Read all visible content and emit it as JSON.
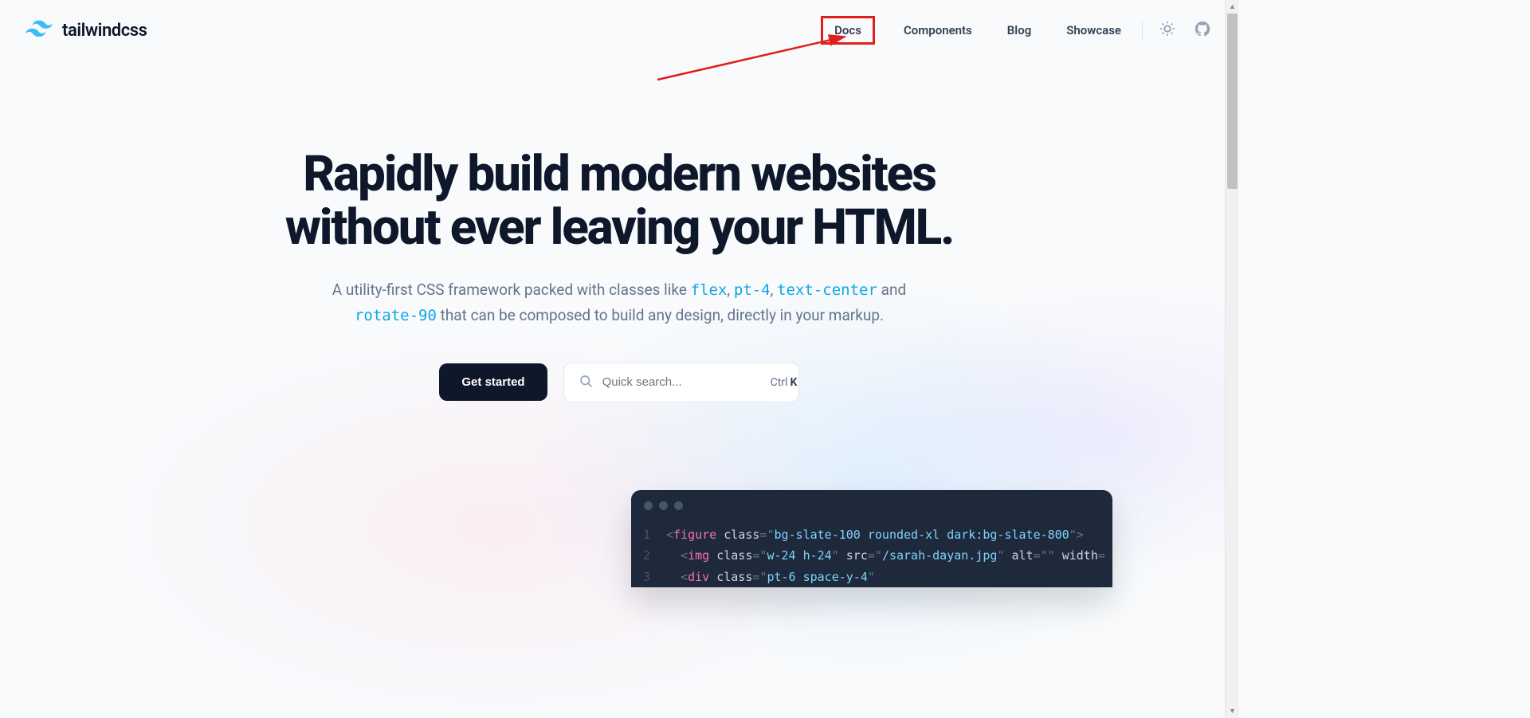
{
  "brand": {
    "name": "tailwindcss"
  },
  "nav": {
    "items": [
      {
        "label": "Docs",
        "highlighted": true
      },
      {
        "label": "Components",
        "highlighted": false
      },
      {
        "label": "Blog",
        "highlighted": false
      },
      {
        "label": "Showcase",
        "highlighted": false
      }
    ]
  },
  "hero": {
    "title_line1": "Rapidly build modern websites",
    "title_line2": "without ever leaving your HTML.",
    "subtitle_pre": "A utility-first CSS framework packed with classes like ",
    "code1": "flex",
    "sep1": ", ",
    "code2": "pt-4",
    "sep2": ", ",
    "code3": "text-center",
    "sep3": " and ",
    "code4": "rotate-90",
    "subtitle_post": " that can be composed to build any design, directly in your markup.",
    "cta_label": "Get started",
    "search_placeholder": "Quick search...",
    "kbd_ctrl": "Ctrl ",
    "kbd_key": "K"
  },
  "code": {
    "lines": [
      {
        "num": "1",
        "indent": "",
        "tokens": [
          {
            "t": "punc",
            "v": "<"
          },
          {
            "t": "tag",
            "v": "figure"
          },
          {
            "t": "plain",
            "v": " "
          },
          {
            "t": "attr",
            "v": "class"
          },
          {
            "t": "punc",
            "v": "="
          },
          {
            "t": "punc",
            "v": "\""
          },
          {
            "t": "str",
            "v": "bg-slate-100 rounded-xl dark:bg-slate-800"
          },
          {
            "t": "punc",
            "v": "\""
          },
          {
            "t": "punc",
            "v": ">"
          }
        ]
      },
      {
        "num": "2",
        "indent": "  ",
        "tokens": [
          {
            "t": "punc",
            "v": "<"
          },
          {
            "t": "tag",
            "v": "img"
          },
          {
            "t": "plain",
            "v": " "
          },
          {
            "t": "attr",
            "v": "class"
          },
          {
            "t": "punc",
            "v": "="
          },
          {
            "t": "punc",
            "v": "\""
          },
          {
            "t": "str",
            "v": "w-24 h-24"
          },
          {
            "t": "punc",
            "v": "\""
          },
          {
            "t": "plain",
            "v": " "
          },
          {
            "t": "attr",
            "v": "src"
          },
          {
            "t": "punc",
            "v": "="
          },
          {
            "t": "punc",
            "v": "\""
          },
          {
            "t": "str",
            "v": "/sarah-dayan.jpg"
          },
          {
            "t": "punc",
            "v": "\""
          },
          {
            "t": "plain",
            "v": " "
          },
          {
            "t": "attr",
            "v": "alt"
          },
          {
            "t": "punc",
            "v": "="
          },
          {
            "t": "punc",
            "v": "\""
          },
          {
            "t": "punc",
            "v": "\""
          },
          {
            "t": "plain",
            "v": " "
          },
          {
            "t": "attr",
            "v": "width"
          },
          {
            "t": "punc",
            "v": "="
          }
        ]
      },
      {
        "num": "3",
        "indent": "  ",
        "tokens": [
          {
            "t": "punc",
            "v": "<"
          },
          {
            "t": "tag",
            "v": "div"
          },
          {
            "t": "plain",
            "v": " "
          },
          {
            "t": "attr",
            "v": "class"
          },
          {
            "t": "punc",
            "v": "="
          },
          {
            "t": "punc",
            "v": "\""
          },
          {
            "t": "str",
            "v": "pt-6 space-y-4"
          },
          {
            "t": "punc",
            "v": "\""
          }
        ]
      }
    ]
  }
}
